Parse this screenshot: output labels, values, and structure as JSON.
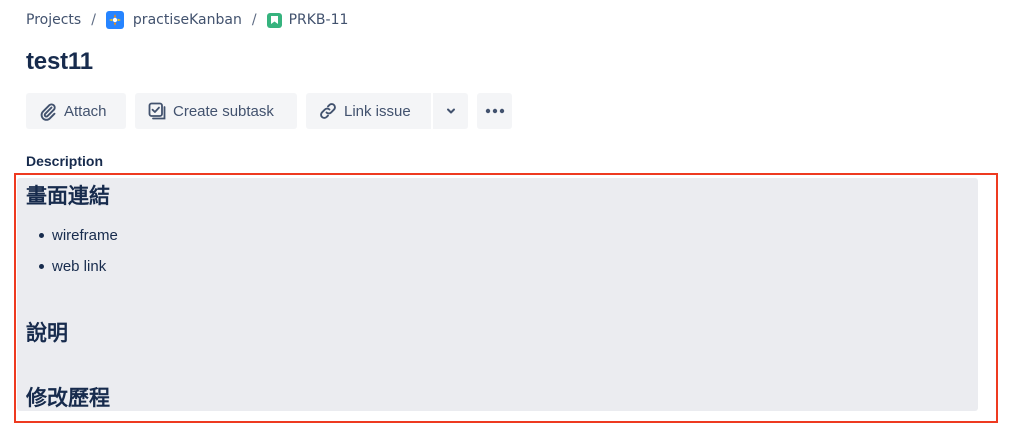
{
  "breadcrumb": {
    "projects": "Projects",
    "separator": "/",
    "project": "practiseKanban",
    "issue_key": "PRKB-11"
  },
  "issue": {
    "title": "test11"
  },
  "toolbar": {
    "attach": "Attach",
    "create_subtask": "Create subtask",
    "link_issue": "Link issue"
  },
  "description": {
    "label": "Description",
    "heading_links": "畫面連結",
    "links": [
      "wireframe",
      "web link"
    ],
    "heading_explain": "說明",
    "heading_history": "修改歷程"
  },
  "colors": {
    "text": "#172b4d",
    "button_bg": "#f4f5f7",
    "description_bg": "#ebecf0",
    "highlight_border": "#ee3a20",
    "project_icon": "#2684ff",
    "story_icon": "#36b37e"
  },
  "icons": [
    "project-icon",
    "story-icon",
    "paperclip-icon",
    "subtask-icon",
    "link-icon",
    "chevron-down-icon",
    "more-icon"
  ]
}
